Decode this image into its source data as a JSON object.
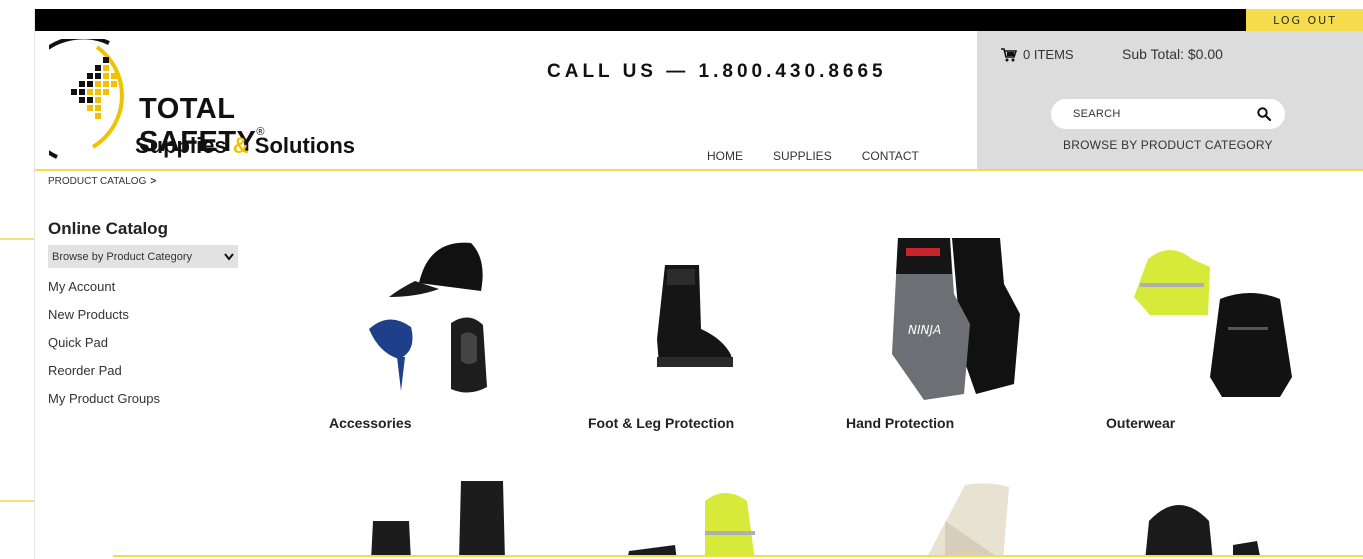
{
  "topbar": {
    "logout_label": "LOG OUT"
  },
  "brand": {
    "name": "TOTAL SAFETY",
    "reg": "®",
    "sub_before": "Supplies ",
    "sub_amp": "&",
    "sub_after": " Solutions"
  },
  "header": {
    "call_us": "CALL US — 1.800.430.8665"
  },
  "nav": {
    "home": "HOME",
    "supplies": "SUPPLIES",
    "contact": "CONTACT"
  },
  "cart": {
    "items_label": "0 ITEMS",
    "subtotal": "Sub Total: $0.00"
  },
  "search": {
    "placeholder": "SEARCH"
  },
  "browse_category": "BROWSE BY PRODUCT CATEGORY",
  "breadcrumb": {
    "label": "PRODUCT CATALOG",
    "sep": ">"
  },
  "sidebar": {
    "title": "Online Catalog",
    "select_value": "Browse by Product Category",
    "links": [
      "My Account",
      "New Products",
      "Quick Pad",
      "Reorder Pad",
      "My Product Groups"
    ]
  },
  "categories": [
    {
      "label": "Accessories",
      "icon": "cap-icon"
    },
    {
      "label": "Foot & Leg Protection",
      "icon": "boot-icon"
    },
    {
      "label": "Hand Protection",
      "icon": "gloves-icon"
    },
    {
      "label": "Outerwear",
      "icon": "jacket-icon"
    }
  ],
  "colors": {
    "accent": "#f5dc4c",
    "panel": "#dcdcdc",
    "topbar": "#000000"
  }
}
